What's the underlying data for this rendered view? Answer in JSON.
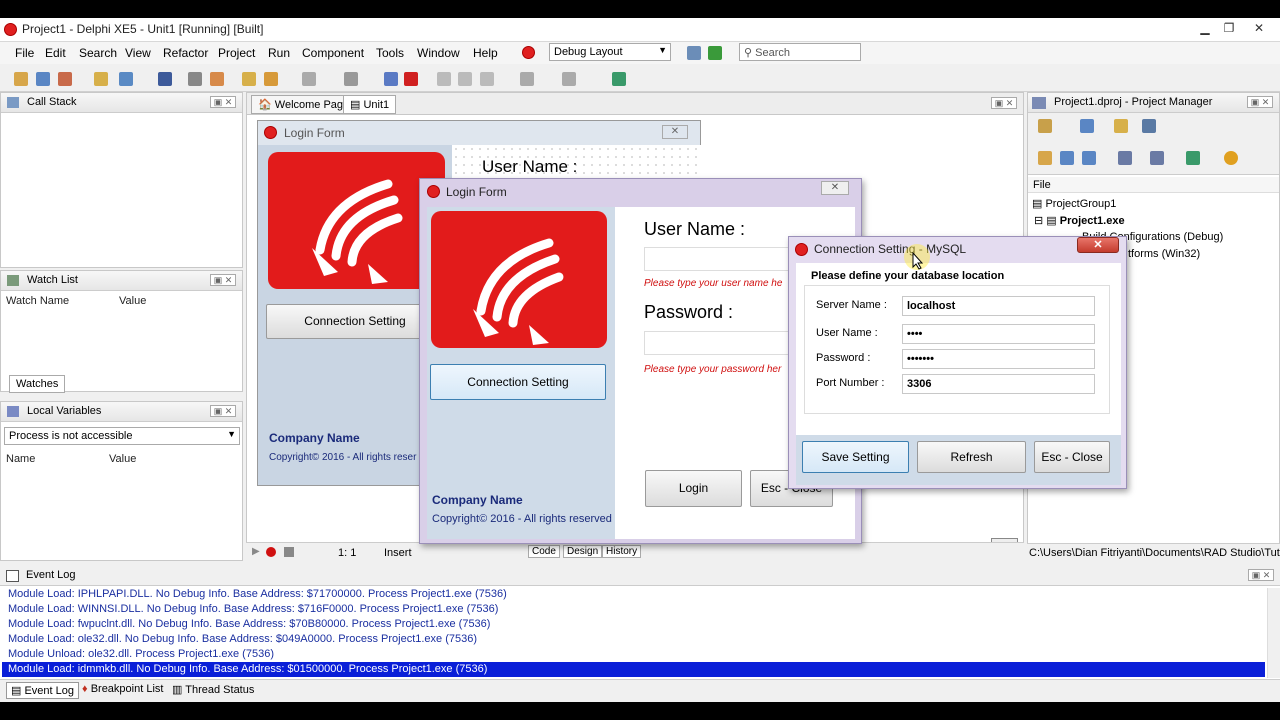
{
  "window": {
    "title": "Project1 - Delphi XE5 - Unit1 [Running] [Built]"
  },
  "menu": [
    "File",
    "Edit",
    "Search",
    "View",
    "Refactor",
    "Project",
    "Run",
    "Component",
    "Tools",
    "Window",
    "Help"
  ],
  "layout_combo": "Debug Layout",
  "search": {
    "placeholder": "Search"
  },
  "left_panels": {
    "call_stack": "Call Stack",
    "watch_list": "Watch List",
    "watch_cols": [
      "Watch Name",
      "Value"
    ],
    "watches_tab": "Watches",
    "local_vars": "Local Variables",
    "process_combo": "Process is not accessible",
    "local_cols": [
      "Name",
      "Value"
    ]
  },
  "editor_tabs": [
    "Welcome Page",
    "Unit1"
  ],
  "designer": {
    "form_caption": "Login Form",
    "user_label_partial": "User Name :",
    "conn_button": "Connection Setting",
    "company": "Company Name",
    "copyright": "Copyright© 2016 - All rights reser"
  },
  "status": {
    "position": "1:   1",
    "mode": "Insert",
    "tabs": [
      "Code",
      "Design",
      "History"
    ]
  },
  "login_form": {
    "caption": "Login Form",
    "user_label": "User Name :",
    "user_error": "Please type your user name he",
    "password_label": "Password :",
    "password_error": "Please type your password her",
    "conn_button": "Connection Setting",
    "company": "Company Name",
    "copyright": "Copyright© 2016 - All rights reserved",
    "login_button": "Login",
    "esc_button": "Esc - Close"
  },
  "conn_dialog": {
    "caption": "Connection Setting - MySQL",
    "heading": "Please define your database location",
    "server_label": "Server Name :",
    "server_value": "localhost",
    "user_label": "User Name :",
    "user_value": "••••",
    "password_label": "Password :",
    "password_value": "•••••••",
    "port_label": "Port Number :",
    "port_value": "3306",
    "save_button": "Save Setting",
    "refresh_button": "Refresh",
    "close_button": "Esc - Close"
  },
  "project_manager": {
    "title": "Project1.dproj - Project Manager",
    "file_header": "File",
    "tree": [
      "ProjectGroup1",
      "Project1.exe",
      "Build Configurations (Debug)",
      "tforms (Win32)"
    ],
    "path": "C:\\Users\\Dian Fitriyanti\\Documents\\RAD Studio\\Tutorial"
  },
  "event_log": {
    "title": "Event Log",
    "lines": [
      "Module Load: IPHLPAPI.DLL. No Debug Info. Base Address: $71700000. Process Project1.exe (7536)",
      "Module Load: WINNSI.DLL. No Debug Info. Base Address: $716F0000. Process Project1.exe (7536)",
      "Module Load: fwpuclnt.dll. No Debug Info. Base Address: $70B80000. Process Project1.exe (7536)",
      "Module Load: ole32.dll. No Debug Info. Base Address: $049A0000. Process Project1.exe (7536)",
      "Module Unload: ole32.dll. Process Project1.exe (7536)",
      "Module Load: idmmkb.dll. No Debug Info. Base Address: $01500000. Process Project1.exe (7536)"
    ],
    "tabs": [
      "Event Log",
      "Breakpoint List",
      "Thread Status"
    ]
  },
  "colors": {
    "accent_red": "#e21b1b",
    "selection_blue": "#0a1fd8",
    "log_text": "#1a2fa0"
  }
}
